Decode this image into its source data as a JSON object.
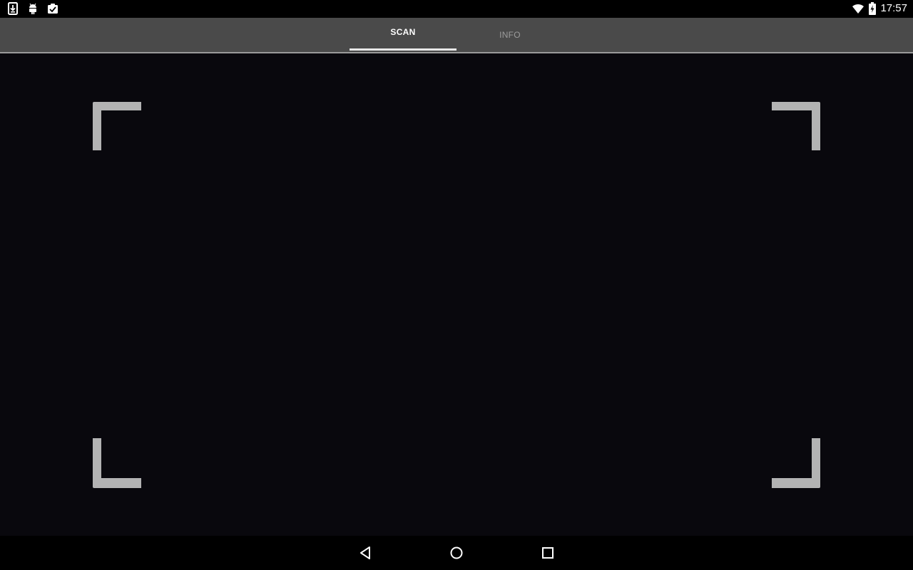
{
  "status_bar": {
    "time": "17:57",
    "left_icons": [
      "download-icon",
      "android-debug-icon",
      "clipboard-check-icon"
    ],
    "right_icons": [
      "wifi-icon",
      "battery-charging-icon"
    ]
  },
  "tabs": [
    {
      "label": "SCAN",
      "selected": true
    },
    {
      "label": "INFO",
      "selected": false
    }
  ],
  "viewfinder": {
    "corner_color": "#b3b3b3",
    "background_color": "#09080d"
  },
  "nav_bar": {
    "buttons": [
      "back-icon",
      "home-icon",
      "recents-icon"
    ]
  },
  "colors": {
    "tab_bar": "#4a4a4a",
    "tab_selected_text": "#ffffff",
    "tab_unselected_text": "#9c9c9c",
    "indicator": "#e8e8e8"
  }
}
